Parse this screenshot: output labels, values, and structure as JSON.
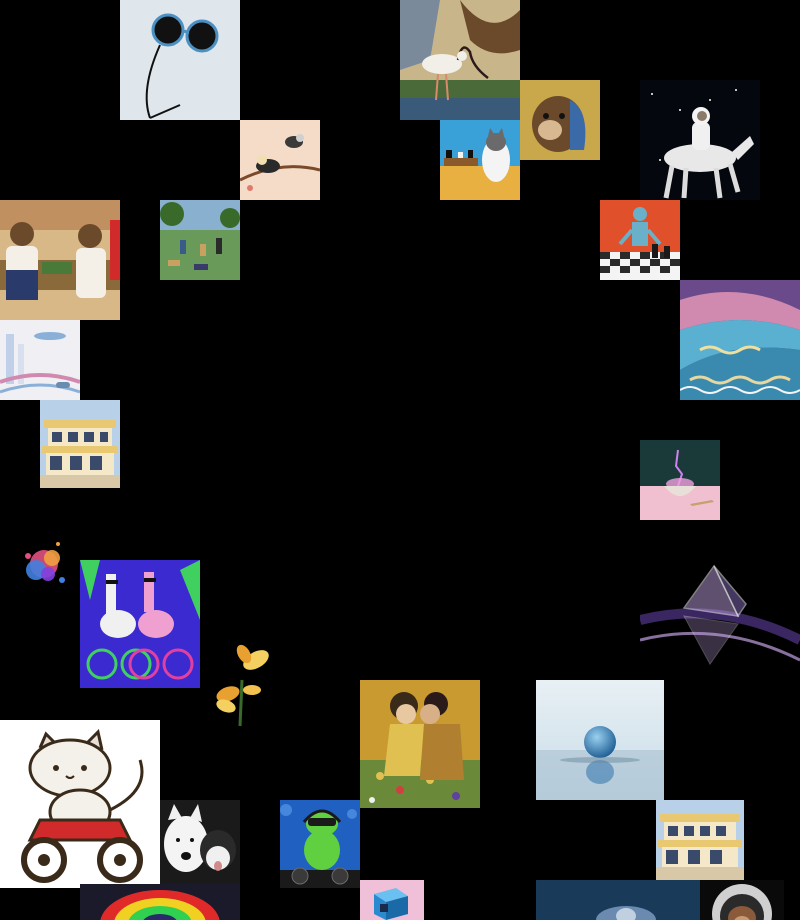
{
  "gallery": {
    "background": "#000000",
    "tiles": [
      {
        "subject": "sunglasses-on-string",
        "colors": [
          "#d8e2ea",
          "#111111",
          "#4a90c2"
        ]
      },
      {
        "subject": "ibis-painting",
        "colors": [
          "#4a6a3a",
          "#f2efe8",
          "#c9b58a"
        ]
      },
      {
        "subject": "otter-portrait",
        "colors": [
          "#c8a84a",
          "#6a4a2a",
          "#3a6aa8"
        ]
      },
      {
        "subject": "birds-on-branch",
        "colors": [
          "#f4dcc8",
          "#2a2a2a",
          "#a06a3a"
        ]
      },
      {
        "subject": "cat-playing-chess",
        "colors": [
          "#3aa0d8",
          "#e8b040",
          "#f4f4f4"
        ]
      },
      {
        "subject": "astronaut-riding-horse",
        "colors": [
          "#05070f",
          "#eeeeee",
          "#9a8a7a"
        ]
      },
      {
        "subject": "teddy-bears-market-stall",
        "colors": [
          "#d8b886",
          "#6a4a2a",
          "#2a3a6a"
        ]
      },
      {
        "subject": "park-scene-painting",
        "colors": [
          "#6a9a5a",
          "#3a5a8a",
          "#c8a060"
        ]
      },
      {
        "subject": "robot-playing-chess",
        "colors": [
          "#e0502a",
          "#2a2a2a",
          "#6ab0c8"
        ]
      },
      {
        "subject": "impasto-river-landscape",
        "colors": [
          "#5ab0d0",
          "#e8d8a0",
          "#6a4a8a"
        ]
      },
      {
        "subject": "futuristic-city-sketch",
        "colors": [
          "#f0f0f4",
          "#8ab0d8",
          "#d08ab0"
        ]
      },
      {
        "subject": "modern-villa-building",
        "colors": [
          "#e8c870",
          "#3a4a6a",
          "#8ab0d8"
        ]
      },
      {
        "subject": "glowing-bowl",
        "colors": [
          "#1a2a2a",
          "#f0c0d0",
          "#b060e0"
        ]
      },
      {
        "subject": "paint-powder-explosion",
        "colors": [
          "#e05080",
          "#4080e0",
          "#f0a040"
        ]
      },
      {
        "subject": "llamas-on-bicycles",
        "colors": [
          "#3a2ad0",
          "#f0a0d0",
          "#40d060"
        ]
      },
      {
        "subject": "glass-pyramid",
        "colors": [
          "#0a0a14",
          "#c0a0e0",
          "#ffffff"
        ]
      },
      {
        "subject": "yellow-flowers",
        "colors": [
          "#e8a030",
          "#f4d060",
          "#3a6a2a"
        ]
      },
      {
        "subject": "klimt-style-kiss",
        "colors": [
          "#c89a30",
          "#3a2a1a",
          "#e0c050"
        ]
      },
      {
        "subject": "glass-sphere",
        "colors": [
          "#c8dce8",
          "#3a7ab0",
          "#e8f0f4"
        ]
      },
      {
        "subject": "cartoon-cat-on-motorcycle",
        "colors": [
          "#ffffff",
          "#d02a2a",
          "#3a2a1a"
        ]
      },
      {
        "subject": "dogs-cuddling",
        "colors": [
          "#f0f0f0",
          "#2a2a2a",
          "#d08a8a"
        ]
      },
      {
        "subject": "frog-dj",
        "colors": [
          "#2060c0",
          "#60d040",
          "#1a1a1a"
        ]
      },
      {
        "subject": "modern-villa-building-2",
        "colors": [
          "#e8c870",
          "#3a4a6a",
          "#8ab0d8"
        ]
      },
      {
        "subject": "colorful-swirl-painting",
        "colors": [
          "#e02a2a",
          "#30d050",
          "#f0d020"
        ]
      },
      {
        "subject": "blue-cube",
        "colors": [
          "#f0c0d8",
          "#2a8ad0",
          "#1a2a4a"
        ]
      },
      {
        "subject": "blue-scene-partial",
        "colors": [
          "#1a3a5a",
          "#6a8ab0",
          "#c0d0e0"
        ]
      },
      {
        "subject": "monkey-astronaut",
        "colors": [
          "#0a0a0a",
          "#d0d0d0",
          "#8a5a3a"
        ]
      }
    ]
  }
}
